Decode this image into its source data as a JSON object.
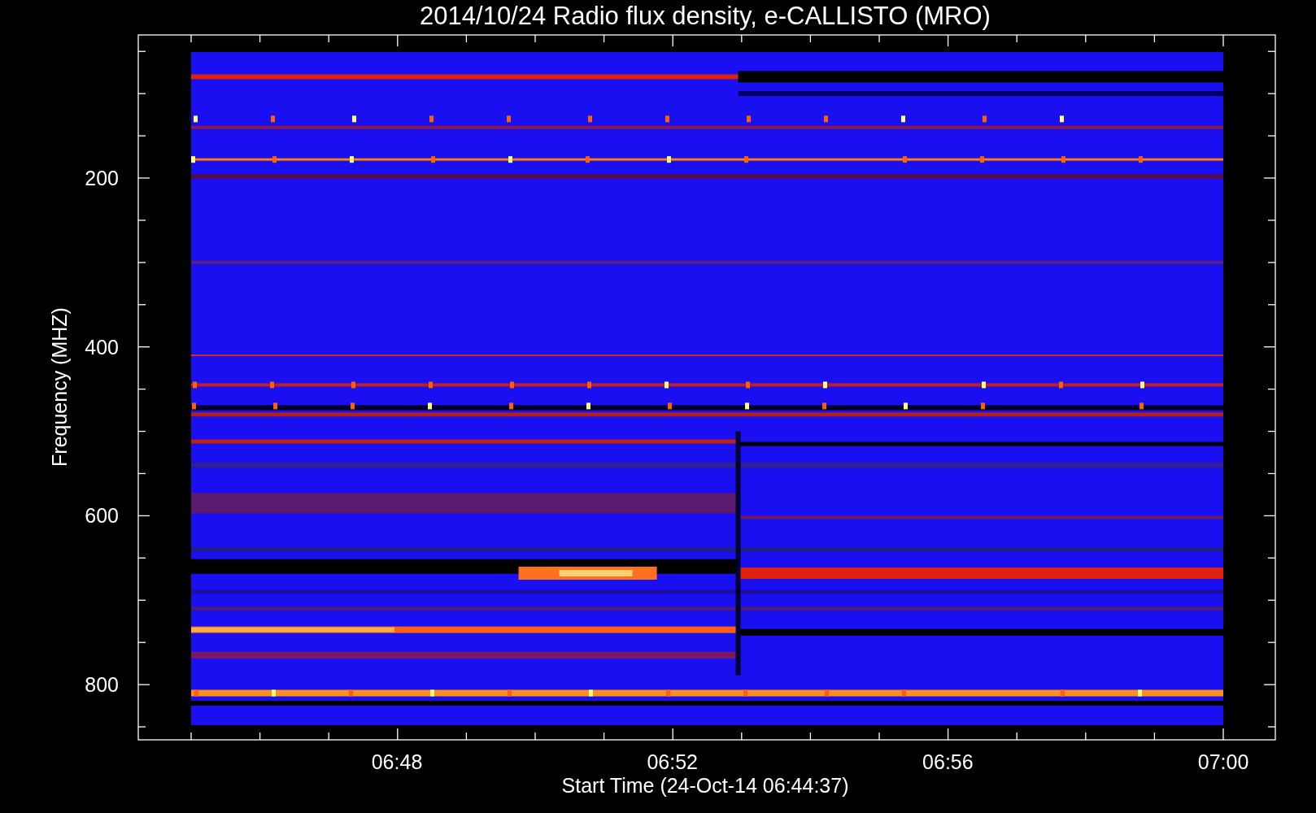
{
  "title": "2014/10/24  Radio flux density, e-CALLISTO (MRO)",
  "y_axis": {
    "label": "Frequency (MHZ)",
    "tick_labels": [
      "200",
      "400",
      "600",
      "800"
    ]
  },
  "x_axis": {
    "label": "Start Time (24-Oct-14 06:44:37)",
    "tick_labels": [
      "06:48",
      "06:52",
      "06:56",
      "07:00"
    ]
  }
}
